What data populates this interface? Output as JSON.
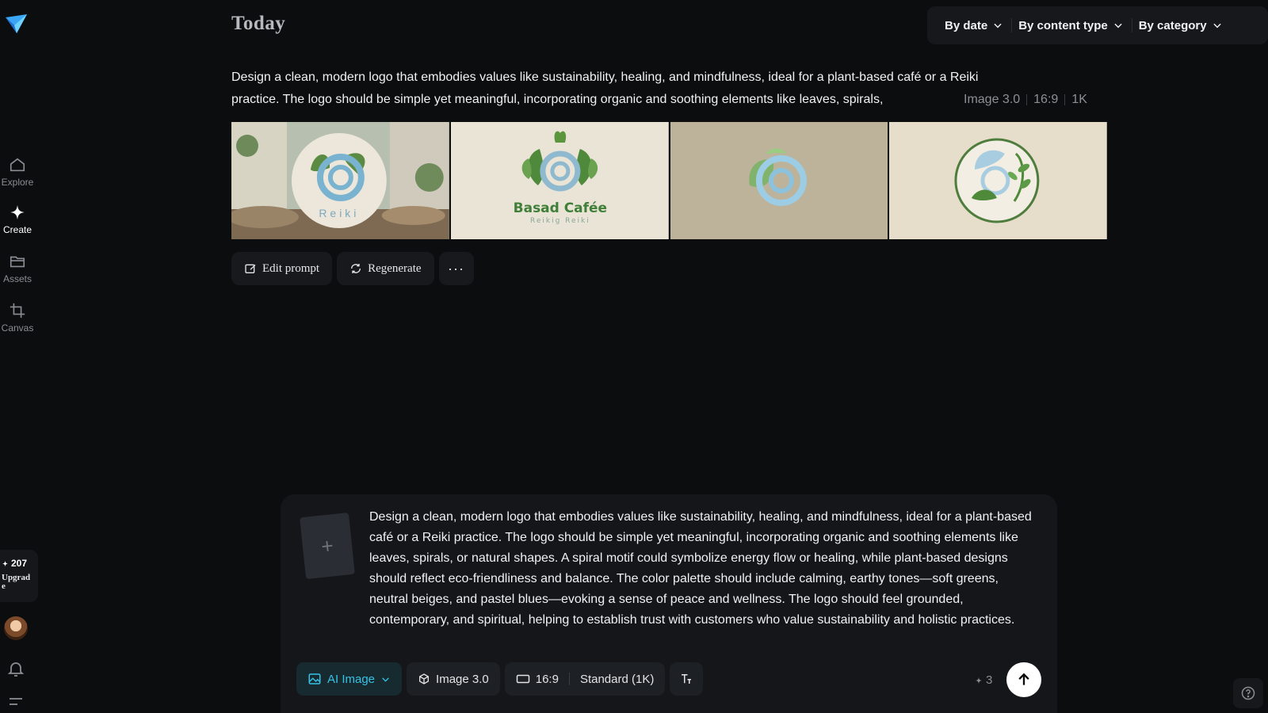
{
  "sidebar": {
    "logo_icon": "paper-plane-logo-icon",
    "items": [
      {
        "label": "Explore",
        "icon": "home-icon"
      },
      {
        "label": "Create",
        "icon": "sparkle-icon"
      },
      {
        "label": "Assets",
        "icon": "folder-icon"
      },
      {
        "label": "Canvas",
        "icon": "crop-icon"
      }
    ],
    "credits": "207",
    "upgrade_label": "Upgrade"
  },
  "header": {
    "title": "Today",
    "filters": [
      "By date",
      "By content type",
      "By category"
    ]
  },
  "generation": {
    "prompt_line1": "Design a clean, modern logo that embodies values like sustainability, healing, and mindfulness, ideal for a plant-based café or a Reiki",
    "prompt_line2": "practice. The logo should be simple yet meaningful, incorporating organic and soothing elements like leaves, spirals,",
    "model": "Image 3.0",
    "ratio": "16:9",
    "resolution": "1K",
    "images": [
      {
        "caption": "Reiki"
      },
      {
        "caption": "Basad Cafée",
        "subcaption": "Reikig Reiki"
      },
      {},
      {}
    ],
    "actions": {
      "edit_prompt": "Edit prompt",
      "regenerate": "Regenerate",
      "more": "···"
    }
  },
  "composer": {
    "add_symbol": "+",
    "prompt": "Design a clean, modern logo that embodies values like sustainability, healing, and mindfulness, ideal for a plant-based café or a Reiki practice. The logo should be simple yet meaningful, incorporating organic and soothing elements like leaves, spirals, or natural shapes. A spiral motif could symbolize energy flow or healing, while plant-based designs should reflect eco-friendliness and balance. The color palette should include calming, earthy tones—soft greens, neutral beiges, and pastel blues—evoking a sense of peace and wellness. The logo should feel grounded, contemporary, and spiritual, helping to establish trust with customers who value sustainability and holistic practices.",
    "mode": "AI Image",
    "model": "Image 3.0",
    "ratio": "16:9",
    "quality": "Standard (1K)",
    "cost": "3"
  },
  "colors": {
    "background": "#0c0d0f",
    "accent": "#35c2e6",
    "panel": "#141619"
  }
}
